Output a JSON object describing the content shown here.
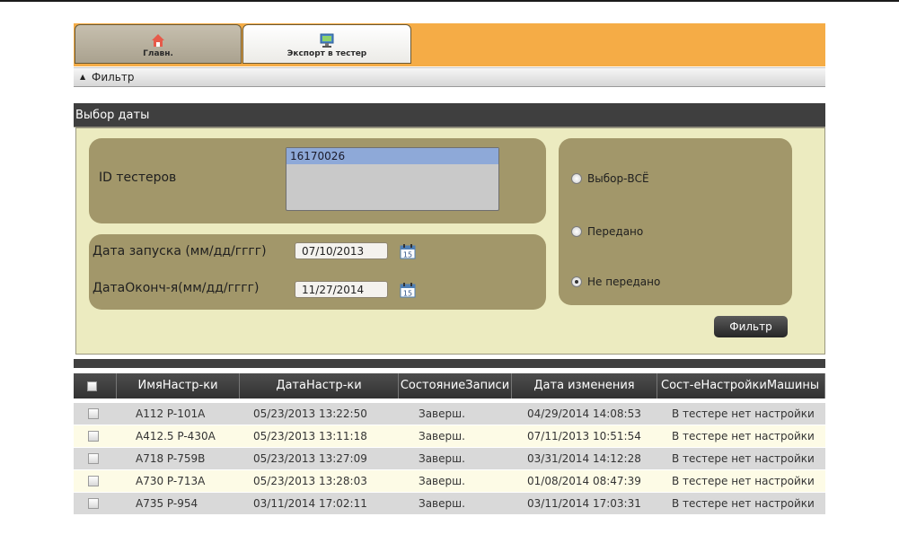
{
  "tabs": {
    "home_label": "Главн.",
    "export_label": "Экспорт в тестер"
  },
  "filter_bar": {
    "label": "Фильтр"
  },
  "date_panel": {
    "title": "Выбор даты",
    "tester_ids_label": "ID тестеров",
    "tester_ids": [
      "16170026"
    ],
    "start_date_label": "Дата запуска (мм/дд/гггг)",
    "start_date": "07/10/2013",
    "end_date_label": "ДатаОконч-я(мм/дд/гггг)",
    "end_date": "11/27/2014",
    "calendar_day": "15",
    "radios": {
      "all": "Выбор-ВСЁ",
      "sent": "Передано",
      "not_sent": "Не передано",
      "selected": "not_sent"
    },
    "filter_button": "Фильтр"
  },
  "grid": {
    "columns": [
      "ИмяНастр-ки",
      "ДатаНастр-ки",
      "СостояниеЗаписи",
      "Дата изменения",
      "Сост-еНастройкиМашины"
    ],
    "rows": [
      [
        "A112 P-101A",
        "05/23/2013 13:22:50",
        "Заверш.",
        "04/29/2014 14:08:53",
        "В тестере нет настройки"
      ],
      [
        "A412.5 P-430A",
        "05/23/2013 13:11:18",
        "Заверш.",
        "07/11/2013 10:51:54",
        "В тестере нет настройки"
      ],
      [
        "A718 P-759B",
        "05/23/2013 13:27:09",
        "Заверш.",
        "03/31/2014 14:12:28",
        "В тестере нет настройки"
      ],
      [
        "A730 P-713A",
        "05/23/2013 13:28:03",
        "Заверш.",
        "01/08/2014 08:47:39",
        "В тестере нет настройки"
      ],
      [
        "A735 P-954",
        "03/11/2014 17:02:11",
        "Заверш.",
        "03/11/2014 17:03:31",
        "В тестере нет настройки"
      ]
    ]
  },
  "colors": {
    "accent_orange": "#f5ac46",
    "panel_bg": "#ecebc0",
    "box_bg": "#a2976a",
    "row_alt": "#fdfbe6",
    "row_base": "#d9d9d9"
  }
}
